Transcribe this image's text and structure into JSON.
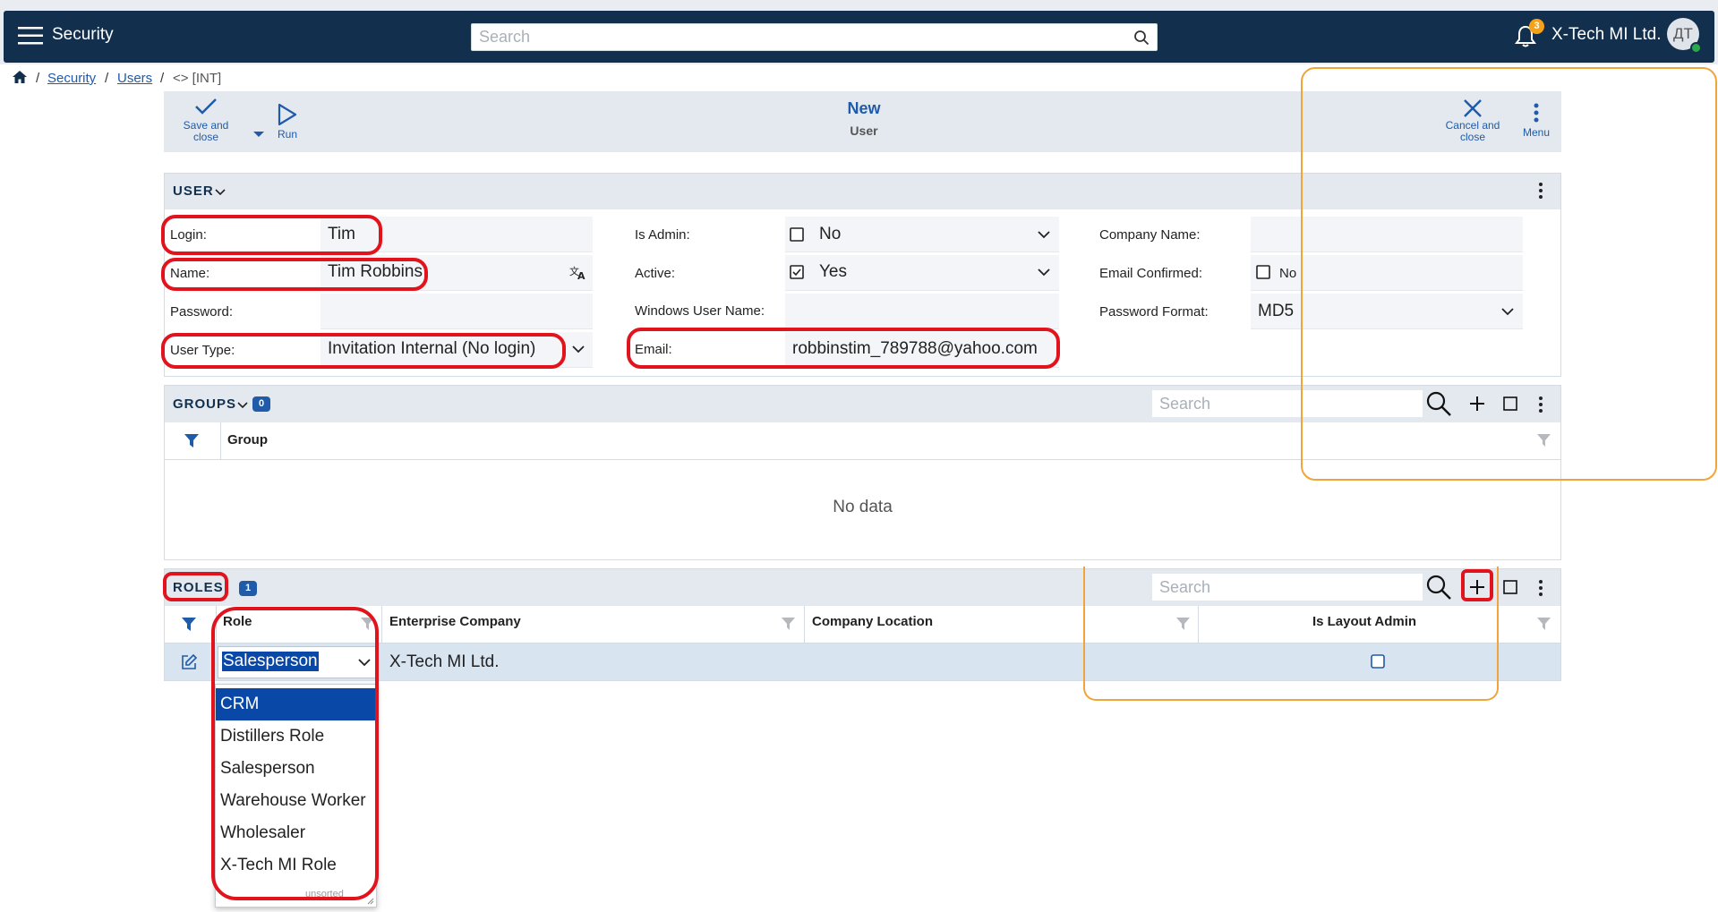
{
  "header": {
    "app_title": "Security",
    "search_placeholder": "Search",
    "notification_count": "3",
    "company": "X-Tech MI Ltd.",
    "avatar_initials": "ДТ"
  },
  "breadcrumb": {
    "security": "Security",
    "users": "Users",
    "current": "<> [INT]"
  },
  "commandbar": {
    "save_close_line1": "Save and",
    "save_close_line2": "close",
    "run": "Run",
    "title": "New",
    "subtitle": "User",
    "cancel_close_line1": "Cancel and",
    "cancel_close_line2": "close",
    "menu": "Menu"
  },
  "user_section": {
    "title": "USER",
    "login_label": "Login:",
    "login_value": "Tim",
    "name_label": "Name:",
    "name_value": "Tim Robbins",
    "password_label": "Password:",
    "usertype_label": "User Type:",
    "usertype_value": "Invitation Internal (No login)",
    "isadmin_label": "Is Admin:",
    "isadmin_value": "No",
    "active_label": "Active:",
    "active_value": "Yes",
    "winuser_label": "Windows User Name:",
    "email_label": "Email:",
    "email_value": "robbinstim_789788@yahoo.com",
    "company_label": "Company Name:",
    "emailconf_label": "Email Confirmed:",
    "emailconf_value": "No",
    "pwdformat_label": "Password Format:",
    "pwdformat_value": "MD5"
  },
  "groups_section": {
    "title": "GROUPS",
    "count": "0",
    "search_placeholder": "Search",
    "column_group": "Group",
    "empty_text": "No data"
  },
  "roles_section": {
    "title": "ROLES",
    "count": "1",
    "search_placeholder": "Search",
    "columns": {
      "role": "Role",
      "enterprise": "Enterprise Company",
      "location": "Company Location",
      "layout_admin": "Is Layout Admin"
    },
    "row": {
      "role": "Salesperson",
      "enterprise": "X-Tech MI Ltd.",
      "location": ""
    },
    "dropdown_options": [
      "CRM",
      "Distillers Role",
      "Salesperson",
      "Warehouse Worker",
      "Wholesaler",
      "X-Tech MI Role"
    ],
    "dropdown_footer": "unsorted"
  },
  "colors": {
    "navbar": "#12304e",
    "accent": "#1f5ba8",
    "selected": "#0a48a8",
    "annotation_red": "#e1141e",
    "annotation_orange": "#f0a53b"
  }
}
